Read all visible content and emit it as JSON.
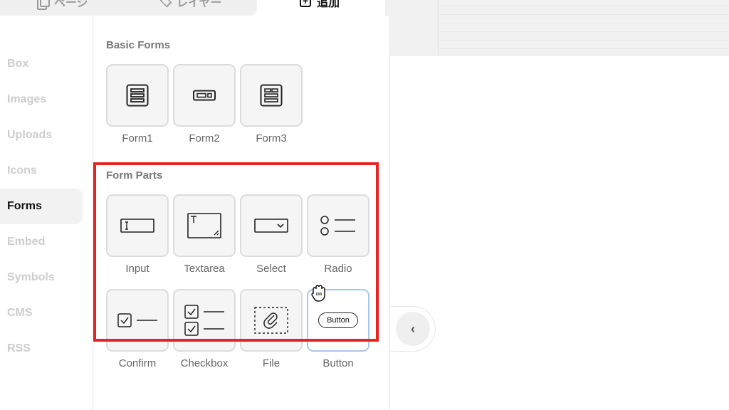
{
  "tabs": [
    {
      "label": "ページ",
      "icon": "pages-icon"
    },
    {
      "label": "レイヤー",
      "icon": "layers-icon"
    },
    {
      "label": "追加",
      "icon": "add-icon"
    }
  ],
  "sidebar": {
    "items": [
      {
        "label": "Box"
      },
      {
        "label": "Images"
      },
      {
        "label": "Uploads"
      },
      {
        "label": "Icons"
      },
      {
        "label": "Forms",
        "active": true
      },
      {
        "label": "Embed"
      },
      {
        "label": "Symbols"
      },
      {
        "label": "CMS"
      },
      {
        "label": "RSS"
      }
    ]
  },
  "sections": {
    "basic_forms": {
      "title": "Basic Forms",
      "items": [
        {
          "label": "Form1",
          "icon": "form-list-icon"
        },
        {
          "label": "Form2",
          "icon": "form-inline-icon"
        },
        {
          "label": "Form3",
          "icon": "form-grid-icon"
        }
      ]
    },
    "form_parts": {
      "title": "Form Parts",
      "items": [
        {
          "label": "Input",
          "icon": "input-icon"
        },
        {
          "label": "Textarea",
          "icon": "textarea-icon"
        },
        {
          "label": "Select",
          "icon": "select-icon"
        },
        {
          "label": "Radio",
          "icon": "radio-icon"
        },
        {
          "label": "Confirm",
          "icon": "confirm-icon"
        },
        {
          "label": "Checkbox",
          "icon": "checkbox-icon"
        },
        {
          "label": "File",
          "icon": "file-icon"
        },
        {
          "label": "Button",
          "icon": "button-icon",
          "button_text": "Button"
        }
      ]
    }
  },
  "colors": {
    "highlight": "#e82121",
    "selected_border": "#a9c6f0"
  },
  "collapse": {
    "glyph": "‹",
    "icon": "chevron-left-icon"
  }
}
